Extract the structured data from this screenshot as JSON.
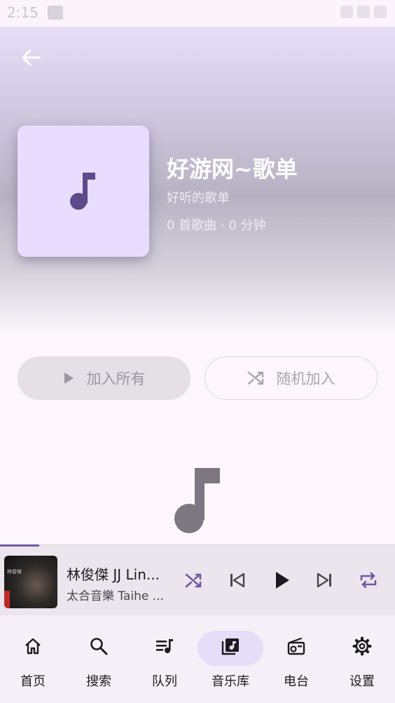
{
  "status_bar": {
    "time": "2:15"
  },
  "playlist": {
    "title": "好游网~歌单",
    "description": "好听的歌单",
    "meta": "0 首歌曲 · 0 分钟"
  },
  "actions": {
    "add_all_label": "加入所有",
    "shuffle_label": "随机加入"
  },
  "mini_player": {
    "song_title": "林俊傑 JJ Lin...",
    "artist": "太合音樂 Taihe ...",
    "art_text": "林俊傑",
    "progress_fraction": 0.1
  },
  "bottom_nav": {
    "items": [
      {
        "label": "首页",
        "icon": "home-icon"
      },
      {
        "label": "搜索",
        "icon": "search-icon"
      },
      {
        "label": "队列",
        "icon": "queue-icon"
      },
      {
        "label": "音乐库",
        "icon": "library-icon",
        "active": true
      },
      {
        "label": "电台",
        "icon": "radio-icon"
      },
      {
        "label": "设置",
        "icon": "gear-icon"
      }
    ]
  },
  "colors": {
    "accent": "#6e5a9e",
    "cover_bg": "#e8ddff",
    "active_nav_pill": "#e6ddf8"
  }
}
